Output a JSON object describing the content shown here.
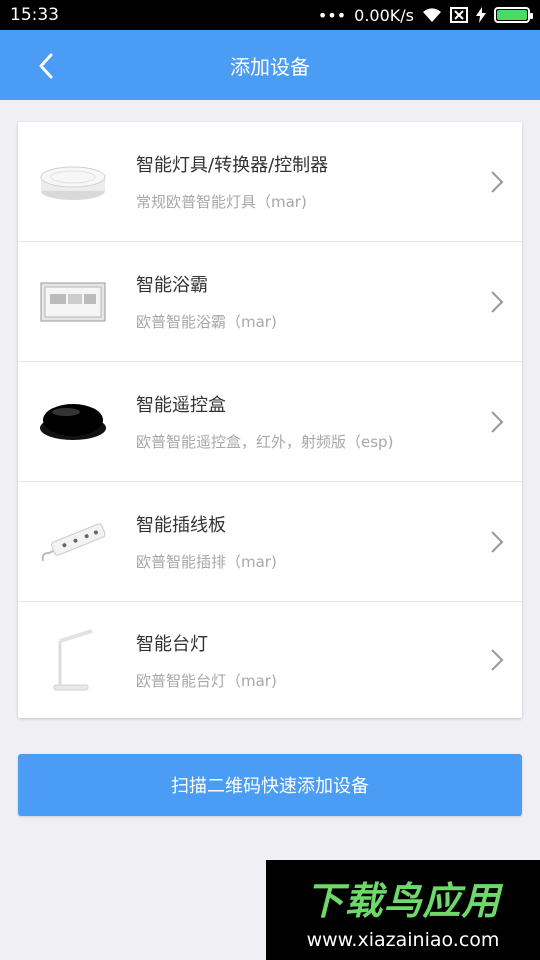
{
  "status_bar": {
    "time": "15:33",
    "dots": "•••",
    "net_speed": "0.00K/s",
    "battery_color": "#4cd964"
  },
  "header": {
    "title": "添加设备",
    "back_icon": "chevron-left-icon",
    "color": "#4a9cf5"
  },
  "devices": [
    {
      "name": "智能灯具/转换器/控制器",
      "desc": "常规欧普智能灯具（mar)",
      "icon": "ceiling-lamp-icon"
    },
    {
      "name": "智能浴霸",
      "desc": "欧普智能浴霸（mar)",
      "icon": "bath-heater-icon"
    },
    {
      "name": "智能遥控盒",
      "desc": "欧普智能遥控盒，红外，射频版（esp)",
      "icon": "remote-box-icon"
    },
    {
      "name": "智能插线板",
      "desc": "欧普智能插排（mar)",
      "icon": "power-strip-icon"
    },
    {
      "name": "智能台灯",
      "desc": "欧普智能台灯（mar)",
      "icon": "desk-lamp-icon"
    }
  ],
  "scan_button": {
    "label": "扫描二维码快速添加设备"
  },
  "watermark": {
    "title": "下载鸟应用",
    "url": "www.xiazainiao.com"
  }
}
